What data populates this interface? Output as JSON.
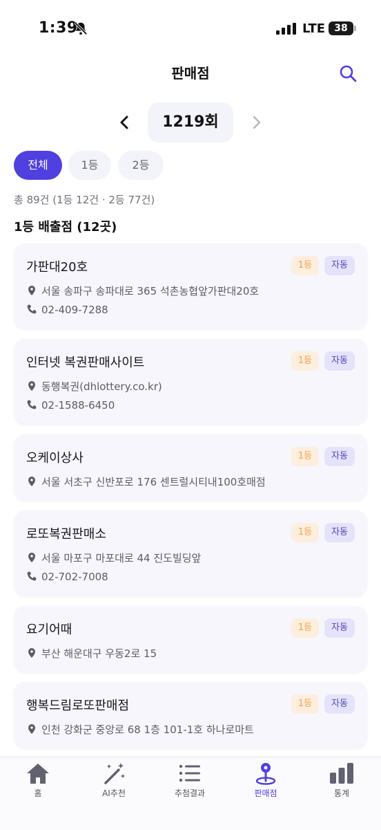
{
  "status_bar": {
    "time": "1:39",
    "network": "LTE",
    "battery": "38"
  },
  "header": {
    "title": "판매점"
  },
  "round_selector": {
    "label": "1219회"
  },
  "filters": [
    {
      "label": "전체",
      "selected": true
    },
    {
      "label": "1등",
      "selected": false
    },
    {
      "label": "2등",
      "selected": false
    }
  ],
  "summary": "총 89건 (1등 12건 · 2등 77건)",
  "section_title": "1등 배출점 (12곳)",
  "stores": [
    {
      "name": "가판대20호",
      "rank": "1등",
      "method": "자동",
      "address": "서울 송파구 송파대로 365 석촌농협앞가판대20호",
      "phone": "02-409-7288"
    },
    {
      "name": "인터넷 복권판매사이트",
      "rank": "1등",
      "method": "자동",
      "address": "동행복권(dhlottery.co.kr)",
      "phone": "02-1588-6450"
    },
    {
      "name": "오케이상사",
      "rank": "1등",
      "method": "자동",
      "address": "서울 서초구 신반포로 176 센트럴시티내100호매점",
      "phone": ""
    },
    {
      "name": "로또복권판매소",
      "rank": "1등",
      "method": "자동",
      "address": "서울 마포구 마포대로 44 진도빌딩앞",
      "phone": "02-702-7008"
    },
    {
      "name": "요기어때",
      "rank": "1등",
      "method": "자동",
      "address": "부산 해운대구 우동2로 15",
      "phone": ""
    },
    {
      "name": "행복드림로또판매점",
      "rank": "1등",
      "method": "자동",
      "address": "인천 강화군 중앙로 68 1층 101-1호 하나로마트",
      "phone": ""
    }
  ],
  "tabs": [
    {
      "label": "홈",
      "icon": "home-icon",
      "active": false
    },
    {
      "label": "AI추천",
      "icon": "magic-wand-icon",
      "active": false
    },
    {
      "label": "추첨결과",
      "icon": "list-icon",
      "active": false
    },
    {
      "label": "판매점",
      "icon": "map-pin-icon",
      "active": true
    },
    {
      "label": "통계",
      "icon": "bar-chart-icon",
      "active": false
    }
  ],
  "colors": {
    "accent": "#4f40df",
    "card_bg": "#f6f6fc",
    "rank_badge_bg": "#fdeede",
    "rank_badge_text": "#f0a14a",
    "method_badge_bg": "#e5e3fb",
    "method_badge_text": "#4e46b8"
  }
}
